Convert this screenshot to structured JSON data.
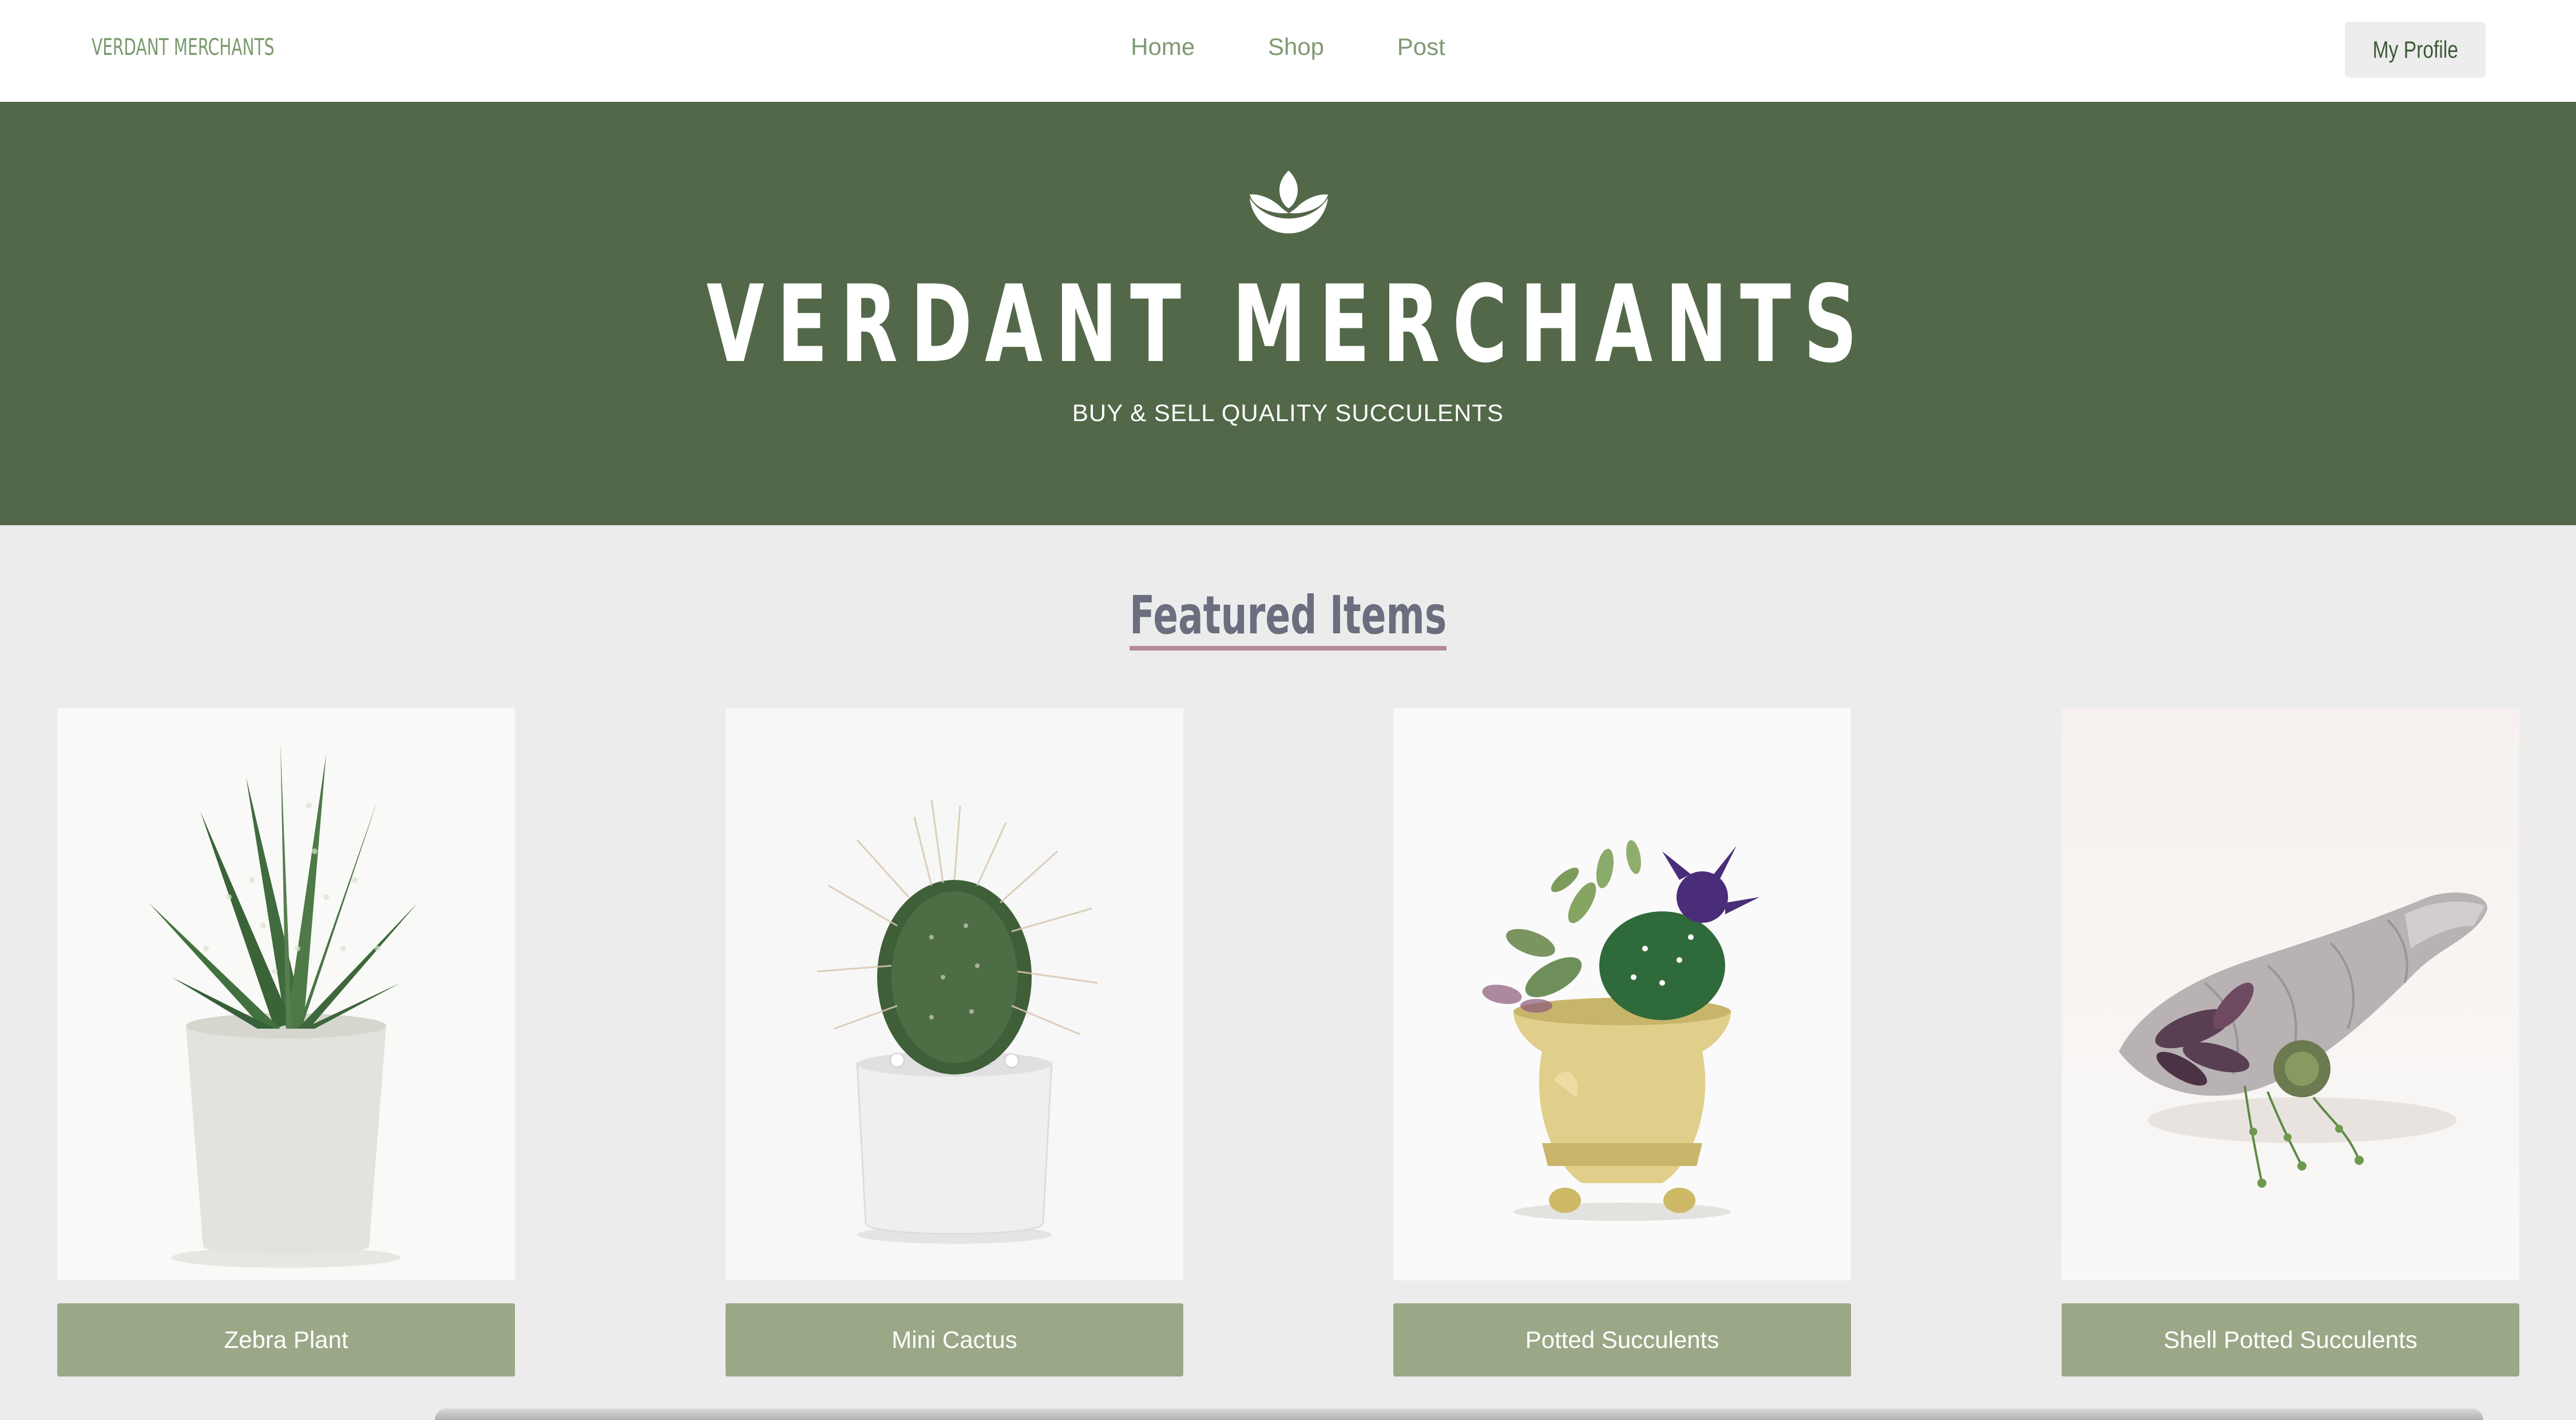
{
  "nav": {
    "brand": "VERDANT MERCHANTS",
    "links": [
      "Home",
      "Shop",
      "Post"
    ],
    "profile_label": "My Profile"
  },
  "hero": {
    "icon": "lotus-icon",
    "title": "VERDANT MERCHANTS",
    "subtitle": "BUY & SELL QUALITY SUCCULENTS"
  },
  "featured": {
    "heading": "Featured Items",
    "items": [
      {
        "name": "Zebra Plant",
        "image": "zebra-plant-photo"
      },
      {
        "name": "Mini Cactus",
        "image": "mini-cactus-photo"
      },
      {
        "name": "Potted Succulents",
        "image": "potted-succulents-photo"
      },
      {
        "name": "Shell Potted Succulents",
        "image": "shell-potted-succulents-photo"
      }
    ]
  },
  "colors": {
    "hero_bg": "#536849",
    "page_bg": "#ececec",
    "button_bg": "#9ba887",
    "nav_text": "#7f9a72",
    "heading_text": "#6a6e7e",
    "heading_underline": "#b68a95"
  }
}
